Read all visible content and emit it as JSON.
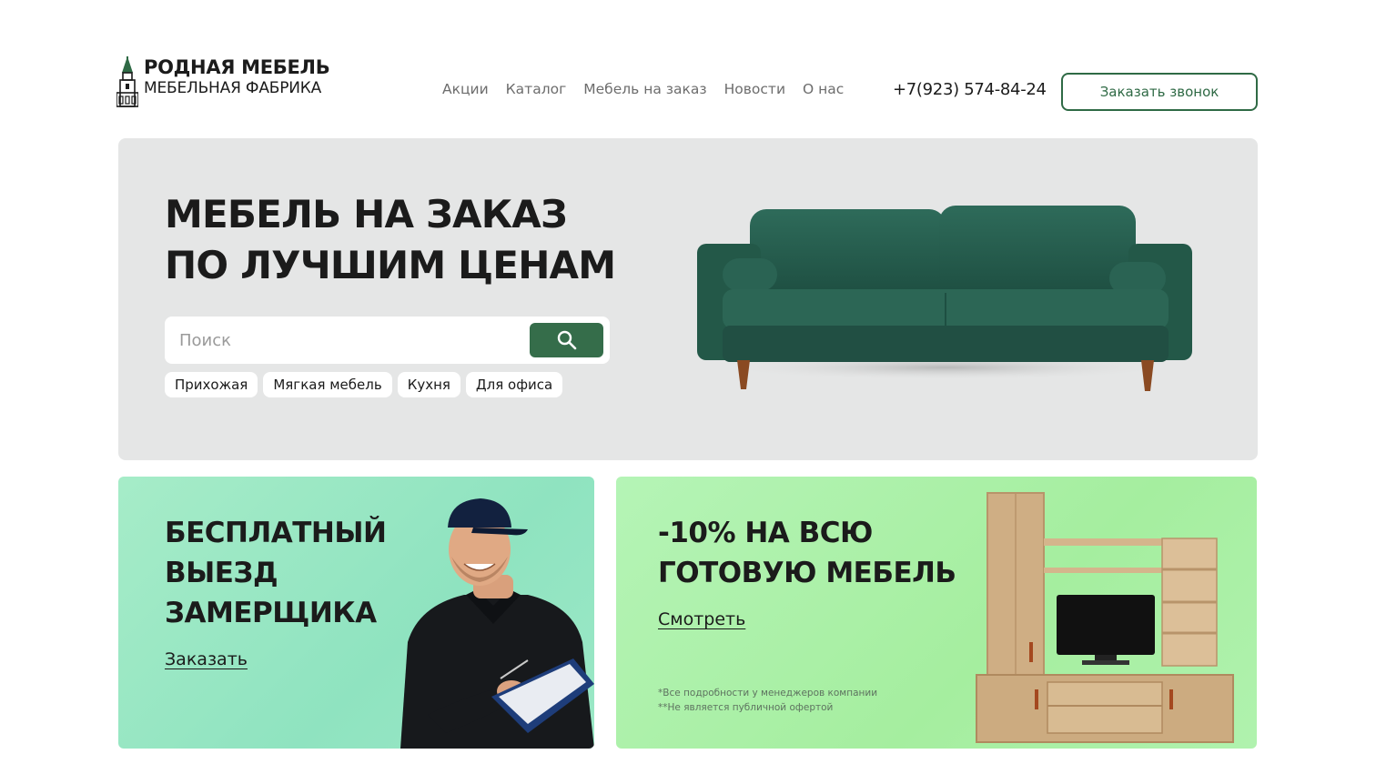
{
  "brand": {
    "name": "РОДНАЯ МЕБЕЛЬ",
    "tagline": "МЕБЕЛЬНАЯ ФАБРИКА",
    "logo_icon": "church-tower-icon",
    "accent_color": "#2f6a45"
  },
  "nav": {
    "items": [
      {
        "label": "Акции"
      },
      {
        "label": "Каталог"
      },
      {
        "label": "Мебель на заказ"
      },
      {
        "label": "Новости"
      },
      {
        "label": "О нас"
      }
    ]
  },
  "contact": {
    "phone": "+7(923) 574-84-24",
    "callback_label": "Заказать звонок"
  },
  "hero": {
    "title_line1": "МЕБЕЛЬ НА ЗАКАЗ",
    "title_line2": "ПО ЛУЧШИМ ЦЕНАМ",
    "search_placeholder": "Поиск",
    "search_value": "",
    "search_icon": "search-icon",
    "chips": [
      {
        "label": "Прихожая"
      },
      {
        "label": "Мягкая мебель"
      },
      {
        "label": "Кухня"
      },
      {
        "label": "Для офиса"
      }
    ],
    "background": "#e5e6e6"
  },
  "promo_left": {
    "title_line1": "БЕСПЛАТНЫЙ",
    "title_line2": "ВЫЕЗД",
    "title_line3": "ЗАМЕРЩИКА",
    "link_label": "Заказать"
  },
  "promo_right": {
    "title_line1": "-10% НА ВСЮ",
    "title_line2": "ГОТОВУЮ МЕБЕЛЬ",
    "link_label": "Смотреть",
    "note1": "*Все подробности у менеджеров компании",
    "note2": "**Не является публичной офертой"
  }
}
